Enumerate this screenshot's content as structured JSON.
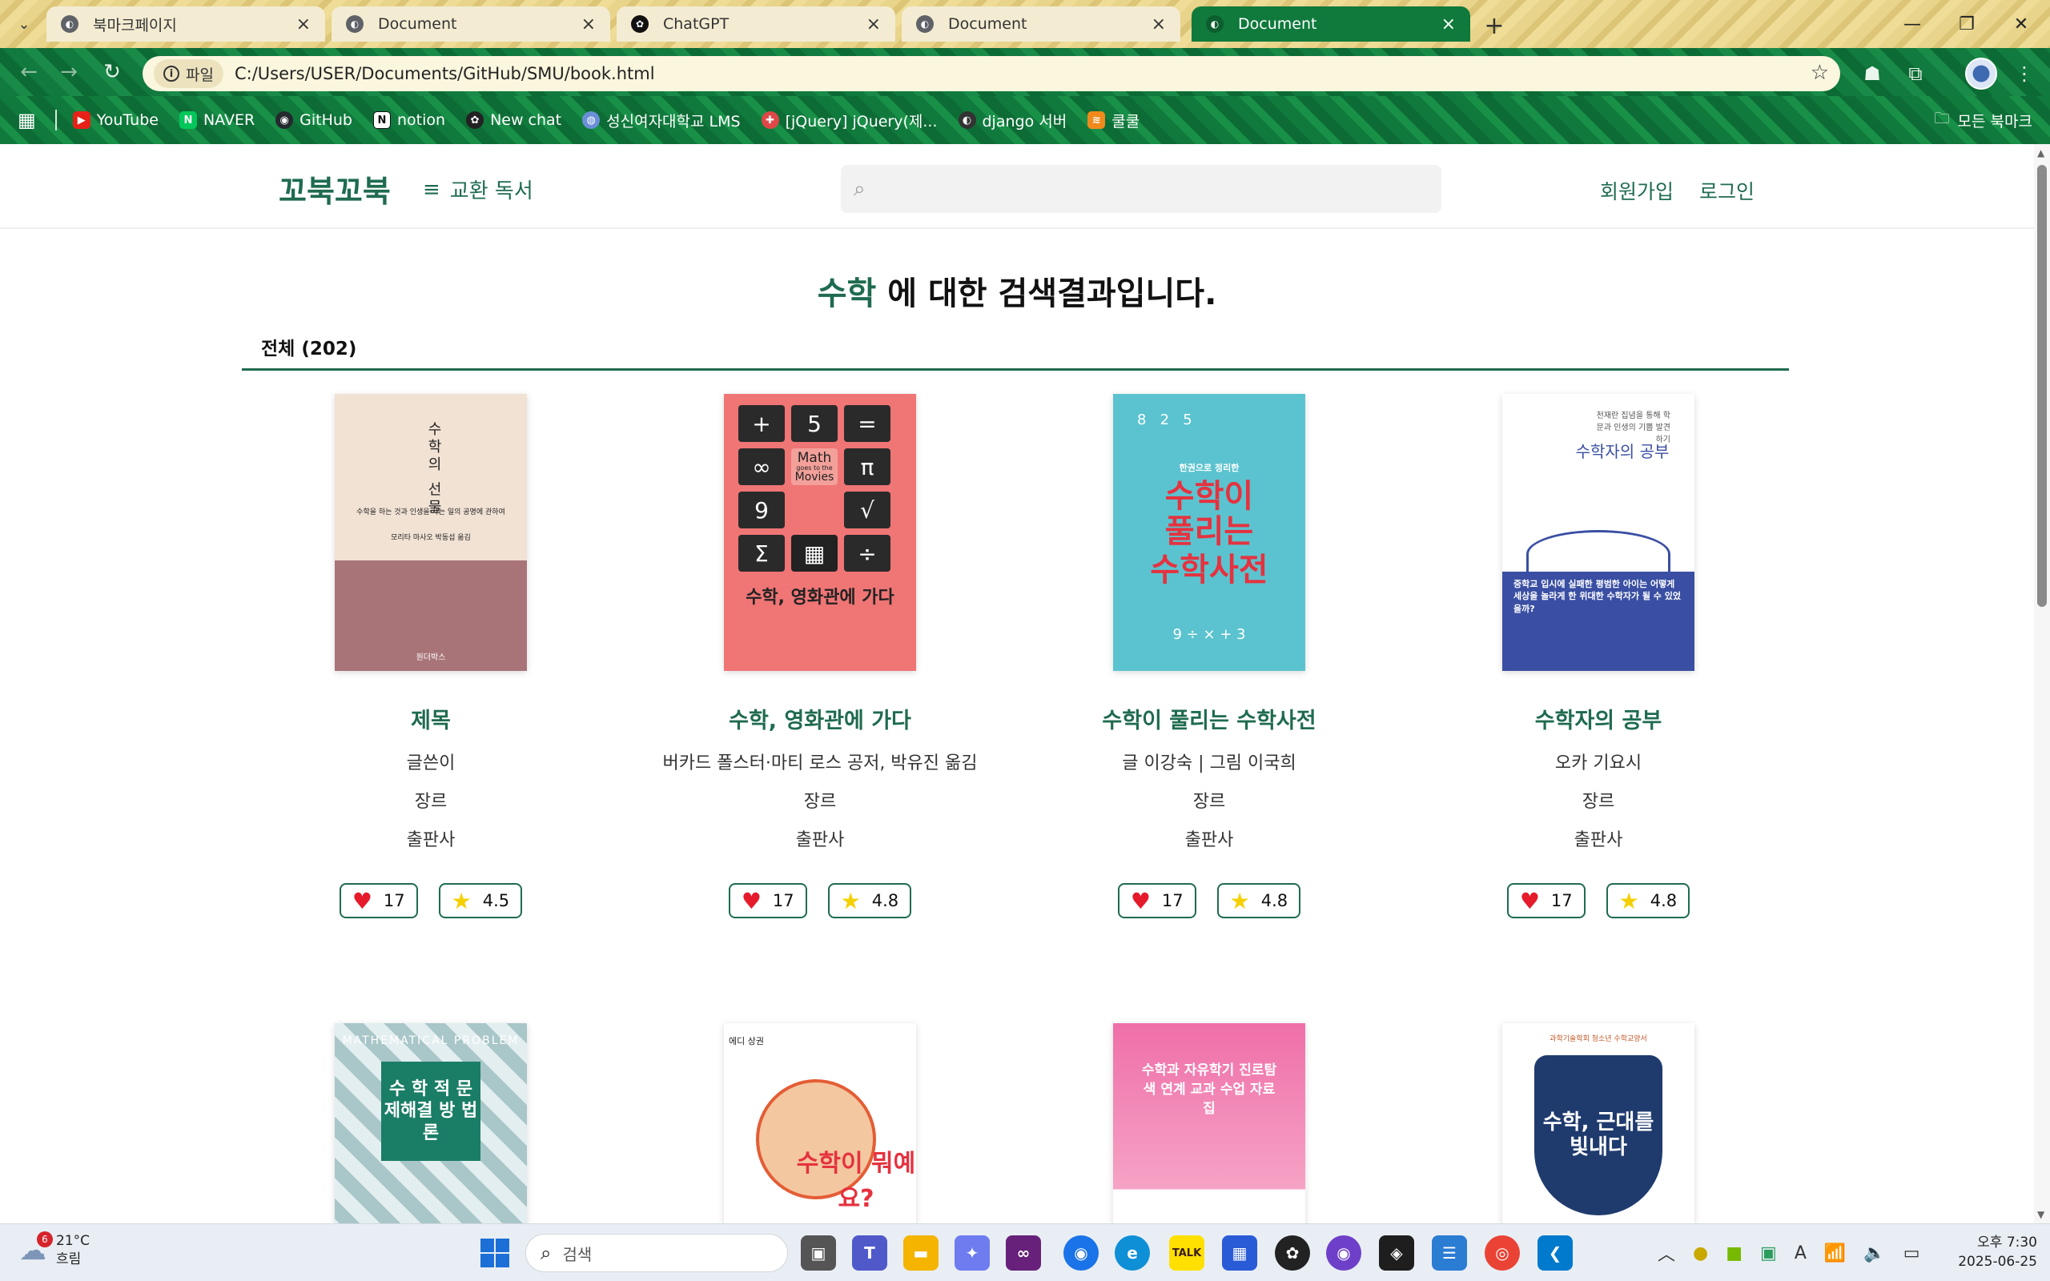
{
  "browser": {
    "tabs": [
      {
        "title": "북마크페이지",
        "active": false
      },
      {
        "title": "Document",
        "active": false
      },
      {
        "title": "ChatGPT",
        "active": false
      },
      {
        "title": "Document",
        "active": false
      },
      {
        "title": "Document",
        "active": true
      }
    ],
    "site_info_label": "파일",
    "url": "C:/Users/USER/Documents/GitHub/SMU/book.html",
    "bookmarks": [
      {
        "label": "YouTube",
        "color": "#e62117"
      },
      {
        "label": "NAVER",
        "color": "#03c75a"
      },
      {
        "label": "GitHub",
        "color": "#24292e"
      },
      {
        "label": "notion",
        "color": "#111111"
      },
      {
        "label": "New chat",
        "color": "#222222"
      },
      {
        "label": "성신여자대학교 LMS",
        "color": "#6b8fd6"
      },
      {
        "label": "[jQuery] jQuery(제...",
        "color": "#e04848"
      },
      {
        "label": "django 서버",
        "color": "#333333"
      },
      {
        "label": "쿨쿨",
        "color": "#f08a1c"
      }
    ],
    "all_bookmarks_label": "모든 북마크"
  },
  "page": {
    "logo": "꼬북꼬북",
    "menu_label": "교환 독서",
    "search_placeholder": "",
    "signup": "회원가입",
    "login": "로그인",
    "result": {
      "keyword": "수학",
      "suffix": " 에 대한 검색결과입니다."
    },
    "tab_all": "전체 (202)",
    "books": [
      {
        "title": "제목",
        "author": "글쓴이",
        "genre": "장르",
        "publisher": "출판사",
        "likes": "17",
        "rating": "4.5",
        "cover_text": {
          "main": "수학의 선물",
          "sub": "수학을 하는 것과 인생을 사는 일의 공명에 관하여",
          "auth": "모리타 마사오 박동섭 옮김",
          "pub": "원더박스"
        }
      },
      {
        "title": "수학, 영화관에 가다",
        "author": "버카드 폴스터·마티 로스 공저, 박유진 옮김",
        "genre": "장르",
        "publisher": "출판사",
        "likes": "17",
        "rating": "4.8",
        "cover_text": {
          "main": "수학, 영화관에 가다",
          "math1": "Math",
          "math2": "goes to the",
          "math3": "Movies"
        }
      },
      {
        "title": "수학이 풀리는 수학사전",
        "author": "글 이강숙 | 그림 이국희",
        "genre": "장르",
        "publisher": "출판사",
        "likes": "17",
        "rating": "4.8",
        "cover_text": {
          "main1": "수학이",
          "main2": "풀리는",
          "main3": "수학사전",
          "badge": "한권으로 정리한"
        }
      },
      {
        "title": "수학자의 공부",
        "author": "오카 기요시",
        "genre": "장르",
        "publisher": "출판사",
        "likes": "17",
        "rating": "4.8",
        "cover_text": {
          "top": "천재란 집념을 통해 학문과 인생의 기쁨 발견하기",
          "main": "수학자의 공부",
          "blue": "중학교 입시에 실패한 평범한 아이는 어떻게 세상을 놀라게 한 위대한 수학자가 될 수 있었을까?"
        }
      }
    ],
    "second_row_covers": [
      {
        "text": "수 학 적 문제해결 방 법 론",
        "small": "MATHEMATICAL PROBLEM"
      },
      {
        "text": "수학이 뭐예요?",
        "small": "에디 상권"
      },
      {
        "text": "수학과 자유학기 진로탐색 연계 교과 수업 자료집"
      },
      {
        "text": "수학, 근대를 빛내다",
        "small": "과학기술학회 청소년 수학교양서"
      }
    ]
  },
  "taskbar": {
    "weather_temp": "21°C",
    "weather_desc": "흐림",
    "weather_badge": "6",
    "search_placeholder": "검색",
    "time": "오후 7:30",
    "date": "2025-06-25"
  },
  "colors": {
    "brand": "#1f6b4f",
    "heart": "#e51b2b",
    "star": "#f5d000",
    "active_tab": "#0f7a3c"
  }
}
